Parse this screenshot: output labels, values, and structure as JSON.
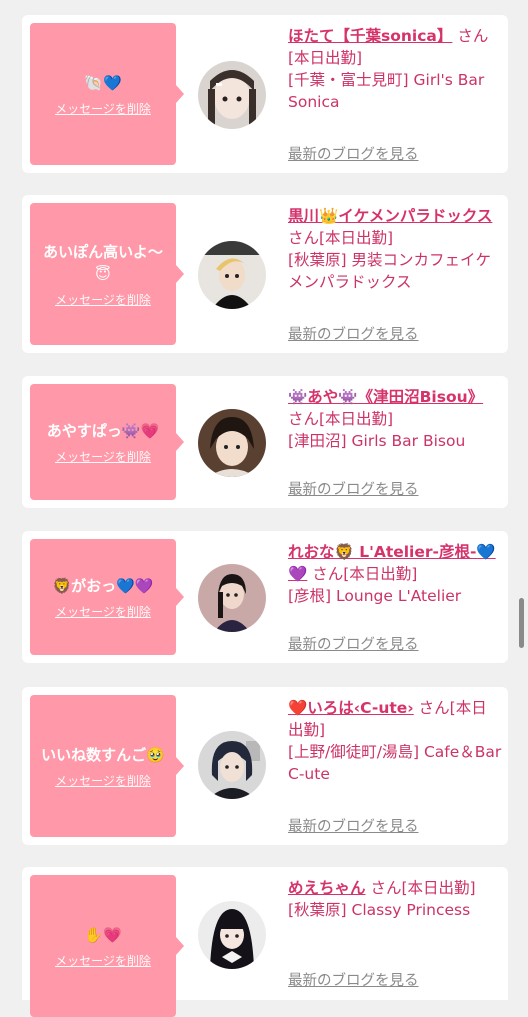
{
  "colors": {
    "bubble": "#ff98a8",
    "accent": "#d6336c",
    "link_gray": "#8a8a8a",
    "background": "#f0f0f0"
  },
  "cards": [
    {
      "message": "🐚💙",
      "delete_label": "メッセージを削除",
      "name": "ほたて【千葉sonica】",
      "san_line": "さん[本日出勤]",
      "store": "[千葉・富士見町] Girl's Bar Sonica",
      "blog_label": "最新のブログを見る"
    },
    {
      "message": "あいぽん高いよ〜😇",
      "delete_label": "メッセージを削除",
      "name": "黒川👑イケメンパラドックス",
      "san_line": "さん[本日出勤]",
      "store": "[秋葉原] 男装コンカフェイケメンパラドックス",
      "blog_label": "最新のブログを見る"
    },
    {
      "message": "あやすぱっ👾💗",
      "delete_label": "メッセージを削除",
      "name": "👾あや👾《津田沼Bisou》",
      "san_line": "さん[本日出勤]",
      "store": "[津田沼] Girls Bar Bisou",
      "blog_label": "最新のブログを見る"
    },
    {
      "message": "🦁がおっ💙💜",
      "delete_label": "メッセージを削除",
      "name": "れおな🦁 L'Atelier-彦根-💙💜",
      "san_line": "さん[本日出勤]",
      "store": "[彦根] Lounge L'Atelier",
      "blog_label": "最新のブログを見る"
    },
    {
      "message": "いいね数すんご🥹",
      "delete_label": "メッセージを削除",
      "name": "❤️いろは‹C-ute›",
      "san_line": "さん[本日出勤]",
      "store": "[上野/御徒町/湯島] Cafe＆Bar C-ute",
      "blog_label": "最新のブログを見る"
    },
    {
      "message": "✋💗",
      "delete_label": "メッセージを削除",
      "name": "めえちゃん",
      "san_line": "さん[本日出勤]",
      "store": "[秋葉原] Classy Princess",
      "blog_label": "最新のブログを見る"
    }
  ]
}
